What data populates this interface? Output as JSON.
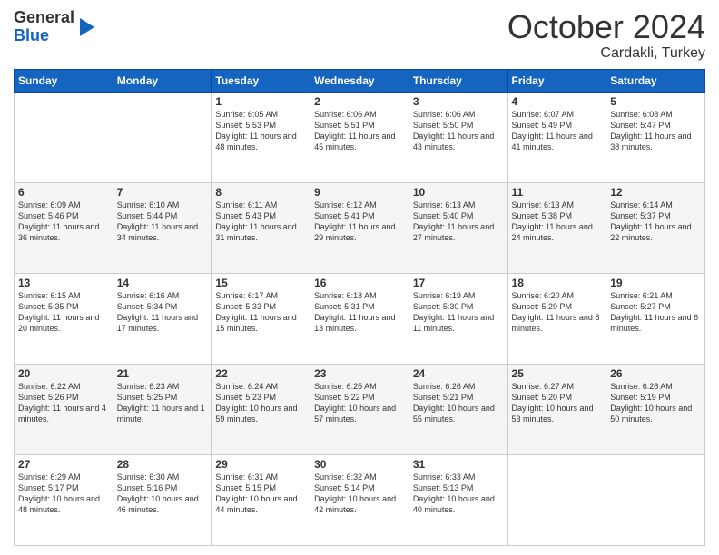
{
  "header": {
    "logo_general": "General",
    "logo_blue": "Blue",
    "month": "October 2024",
    "location": "Cardakli, Turkey"
  },
  "weekdays": [
    "Sunday",
    "Monday",
    "Tuesday",
    "Wednesday",
    "Thursday",
    "Friday",
    "Saturday"
  ],
  "weeks": [
    [
      {
        "day": "",
        "info": ""
      },
      {
        "day": "",
        "info": ""
      },
      {
        "day": "1",
        "info": "Sunrise: 6:05 AM\nSunset: 5:53 PM\nDaylight: 11 hours and 48 minutes."
      },
      {
        "day": "2",
        "info": "Sunrise: 6:06 AM\nSunset: 5:51 PM\nDaylight: 11 hours and 45 minutes."
      },
      {
        "day": "3",
        "info": "Sunrise: 6:06 AM\nSunset: 5:50 PM\nDaylight: 11 hours and 43 minutes."
      },
      {
        "day": "4",
        "info": "Sunrise: 6:07 AM\nSunset: 5:49 PM\nDaylight: 11 hours and 41 minutes."
      },
      {
        "day": "5",
        "info": "Sunrise: 6:08 AM\nSunset: 5:47 PM\nDaylight: 11 hours and 38 minutes."
      }
    ],
    [
      {
        "day": "6",
        "info": "Sunrise: 6:09 AM\nSunset: 5:46 PM\nDaylight: 11 hours and 36 minutes."
      },
      {
        "day": "7",
        "info": "Sunrise: 6:10 AM\nSunset: 5:44 PM\nDaylight: 11 hours and 34 minutes."
      },
      {
        "day": "8",
        "info": "Sunrise: 6:11 AM\nSunset: 5:43 PM\nDaylight: 11 hours and 31 minutes."
      },
      {
        "day": "9",
        "info": "Sunrise: 6:12 AM\nSunset: 5:41 PM\nDaylight: 11 hours and 29 minutes."
      },
      {
        "day": "10",
        "info": "Sunrise: 6:13 AM\nSunset: 5:40 PM\nDaylight: 11 hours and 27 minutes."
      },
      {
        "day": "11",
        "info": "Sunrise: 6:13 AM\nSunset: 5:38 PM\nDaylight: 11 hours and 24 minutes."
      },
      {
        "day": "12",
        "info": "Sunrise: 6:14 AM\nSunset: 5:37 PM\nDaylight: 11 hours and 22 minutes."
      }
    ],
    [
      {
        "day": "13",
        "info": "Sunrise: 6:15 AM\nSunset: 5:35 PM\nDaylight: 11 hours and 20 minutes."
      },
      {
        "day": "14",
        "info": "Sunrise: 6:16 AM\nSunset: 5:34 PM\nDaylight: 11 hours and 17 minutes."
      },
      {
        "day": "15",
        "info": "Sunrise: 6:17 AM\nSunset: 5:33 PM\nDaylight: 11 hours and 15 minutes."
      },
      {
        "day": "16",
        "info": "Sunrise: 6:18 AM\nSunset: 5:31 PM\nDaylight: 11 hours and 13 minutes."
      },
      {
        "day": "17",
        "info": "Sunrise: 6:19 AM\nSunset: 5:30 PM\nDaylight: 11 hours and 11 minutes."
      },
      {
        "day": "18",
        "info": "Sunrise: 6:20 AM\nSunset: 5:29 PM\nDaylight: 11 hours and 8 minutes."
      },
      {
        "day": "19",
        "info": "Sunrise: 6:21 AM\nSunset: 5:27 PM\nDaylight: 11 hours and 6 minutes."
      }
    ],
    [
      {
        "day": "20",
        "info": "Sunrise: 6:22 AM\nSunset: 5:26 PM\nDaylight: 11 hours and 4 minutes."
      },
      {
        "day": "21",
        "info": "Sunrise: 6:23 AM\nSunset: 5:25 PM\nDaylight: 11 hours and 1 minute."
      },
      {
        "day": "22",
        "info": "Sunrise: 6:24 AM\nSunset: 5:23 PM\nDaylight: 10 hours and 59 minutes."
      },
      {
        "day": "23",
        "info": "Sunrise: 6:25 AM\nSunset: 5:22 PM\nDaylight: 10 hours and 57 minutes."
      },
      {
        "day": "24",
        "info": "Sunrise: 6:26 AM\nSunset: 5:21 PM\nDaylight: 10 hours and 55 minutes."
      },
      {
        "day": "25",
        "info": "Sunrise: 6:27 AM\nSunset: 5:20 PM\nDaylight: 10 hours and 53 minutes."
      },
      {
        "day": "26",
        "info": "Sunrise: 6:28 AM\nSunset: 5:19 PM\nDaylight: 10 hours and 50 minutes."
      }
    ],
    [
      {
        "day": "27",
        "info": "Sunrise: 6:29 AM\nSunset: 5:17 PM\nDaylight: 10 hours and 48 minutes."
      },
      {
        "day": "28",
        "info": "Sunrise: 6:30 AM\nSunset: 5:16 PM\nDaylight: 10 hours and 46 minutes."
      },
      {
        "day": "29",
        "info": "Sunrise: 6:31 AM\nSunset: 5:15 PM\nDaylight: 10 hours and 44 minutes."
      },
      {
        "day": "30",
        "info": "Sunrise: 6:32 AM\nSunset: 5:14 PM\nDaylight: 10 hours and 42 minutes."
      },
      {
        "day": "31",
        "info": "Sunrise: 6:33 AM\nSunset: 5:13 PM\nDaylight: 10 hours and 40 minutes."
      },
      {
        "day": "",
        "info": ""
      },
      {
        "day": "",
        "info": ""
      }
    ]
  ]
}
